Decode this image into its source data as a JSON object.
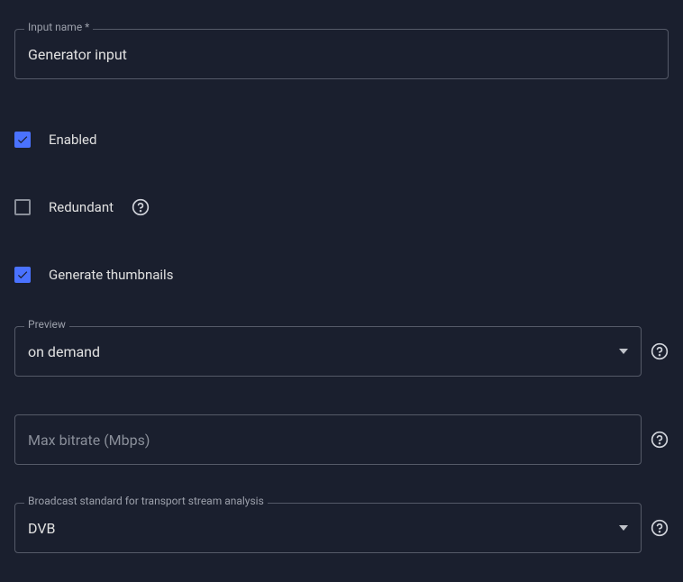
{
  "input_name": {
    "label": "Input name *",
    "value": "Generator input"
  },
  "enabled": {
    "label": "Enabled",
    "checked": true
  },
  "redundant": {
    "label": "Redundant",
    "checked": false
  },
  "generate_thumbnails": {
    "label": "Generate thumbnails",
    "checked": true
  },
  "preview": {
    "label": "Preview",
    "value": "on demand"
  },
  "max_bitrate": {
    "placeholder": "Max bitrate (Mbps)",
    "value": ""
  },
  "broadcast_standard": {
    "label": "Broadcast standard for transport stream analysis",
    "value": "DVB"
  }
}
